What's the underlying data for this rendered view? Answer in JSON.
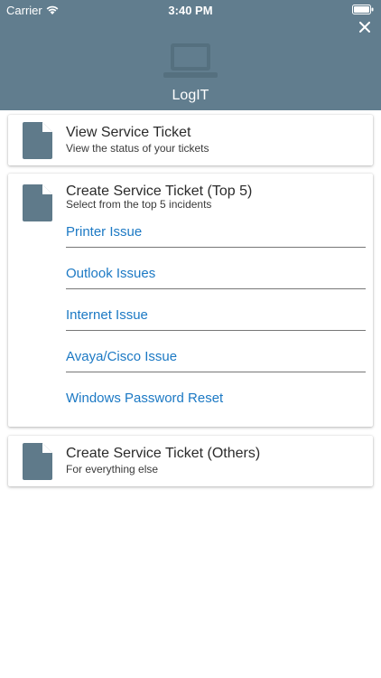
{
  "status_bar": {
    "carrier": "Carrier",
    "time": "3:40 PM"
  },
  "header": {
    "title": "LogIT",
    "icon": "laptop-icon"
  },
  "cards": {
    "view": {
      "title": "View Service Ticket",
      "subtitle": "View the status of your tickets"
    },
    "top5": {
      "title": "Create Service Ticket (Top 5)",
      "subtitle": "Select from the top 5 incidents",
      "issues": [
        "Printer Issue",
        "Outlook Issues",
        "Internet Issue",
        "Avaya/Cisco Issue",
        "Windows Password Reset"
      ]
    },
    "others": {
      "title": "Create Service Ticket (Others)",
      "subtitle": "For everything else"
    }
  },
  "colors": {
    "header_bg": "#617d8e",
    "link": "#1c79c4",
    "icon": "#5f7a8a"
  }
}
